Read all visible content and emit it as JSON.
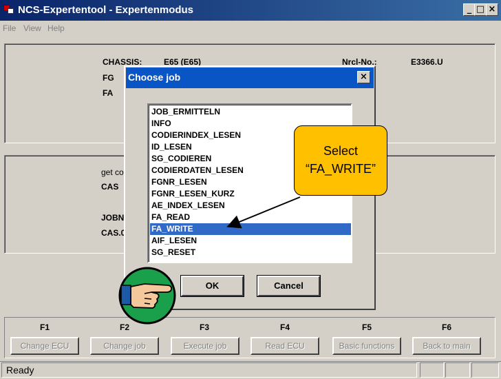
{
  "window": {
    "title": "NCS-Expertentool - Expertenmodus",
    "minimize": "_",
    "maximize": "□",
    "close": "×"
  },
  "menu": [
    "File",
    "View",
    "Help"
  ],
  "info_panel": {
    "chassis_label": "CHASSIS:",
    "chassis_value": "E65 (E65)",
    "fg_label": "FG",
    "fa_label": "FA",
    "nrcl_label": "Nrcl-No.:",
    "nrcl_value": "E3366.U"
  },
  "job_panel": {
    "line1": "get co",
    "line2": "CAS",
    "line3": "JOBN",
    "line4": "CAS.0"
  },
  "dialog": {
    "title": "Choose job",
    "close": "×",
    "jobs": [
      "JOB_ERMITTELN",
      "INFO",
      "CODIERINDEX_LESEN",
      "ID_LESEN",
      "SG_CODIEREN",
      "CODIERDATEN_LESEN",
      "FGNR_LESEN",
      "FGNR_LESEN_KURZ",
      "AE_INDEX_LESEN",
      "FA_READ",
      "FA_WRITE",
      "AIF_LESEN",
      "SG_RESET"
    ],
    "selected": "FA_WRITE",
    "ok": "OK",
    "cancel": "Cancel"
  },
  "callout": {
    "line1": "Select",
    "line2": "“FA_WRITE”"
  },
  "function_keys": [
    {
      "key": "F1",
      "label": "Change ECU"
    },
    {
      "key": "F2",
      "label": "Change job"
    },
    {
      "key": "F3",
      "label": "Execute job"
    },
    {
      "key": "F4",
      "label": "Read ECU"
    },
    {
      "key": "F5",
      "label": "Basic functions"
    },
    {
      "key": "F6",
      "label": "Back to main"
    }
  ],
  "status": "Ready",
  "colors": {
    "titlebar": "#0a246a",
    "dialog_title": "#0a55c6",
    "selection": "#3169c6",
    "callout": "#ffc000",
    "hand_badge": "#1aa04a"
  },
  "icons": {
    "hand": "pointing-hand-icon",
    "arrow": "callout-arrow"
  }
}
